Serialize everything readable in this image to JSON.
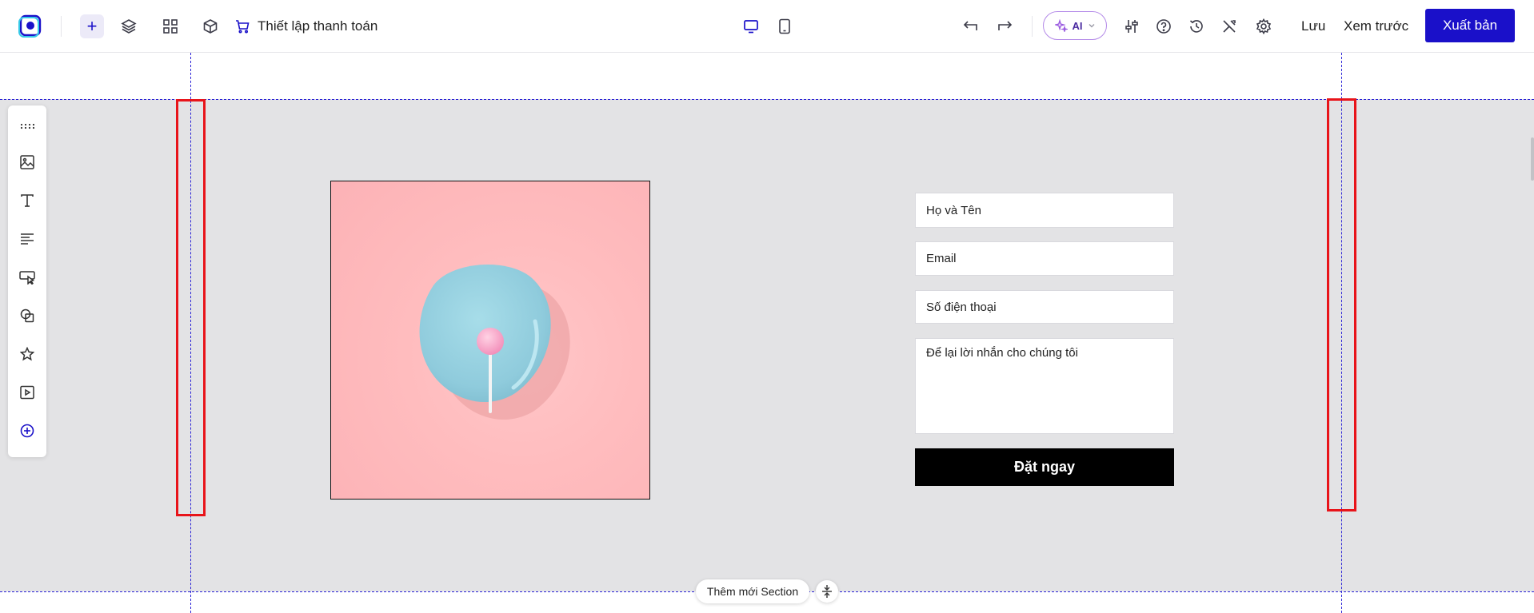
{
  "toolbar": {
    "checkout_label": "Thiết lập thanh toán",
    "ai_label": "AI",
    "save_label": "Lưu",
    "preview_label": "Xem trước",
    "publish_label": "Xuất bản",
    "accent_color": "#1a10c9"
  },
  "sidebar": {
    "items": [
      "drag-handle-icon",
      "image-icon",
      "text-icon",
      "paragraph-icon",
      "button-icon",
      "shapes-icon",
      "star-icon",
      "video-icon",
      "add-element-icon"
    ]
  },
  "form": {
    "name_placeholder": "Họ và Tên",
    "email_placeholder": "Email",
    "phone_placeholder": "Số điện thoại",
    "message_placeholder": "Để lại lời nhắn cho chúng tôi",
    "submit_label": "Đặt ngay"
  },
  "canvas": {
    "add_section_label": "Thêm mới Section"
  }
}
